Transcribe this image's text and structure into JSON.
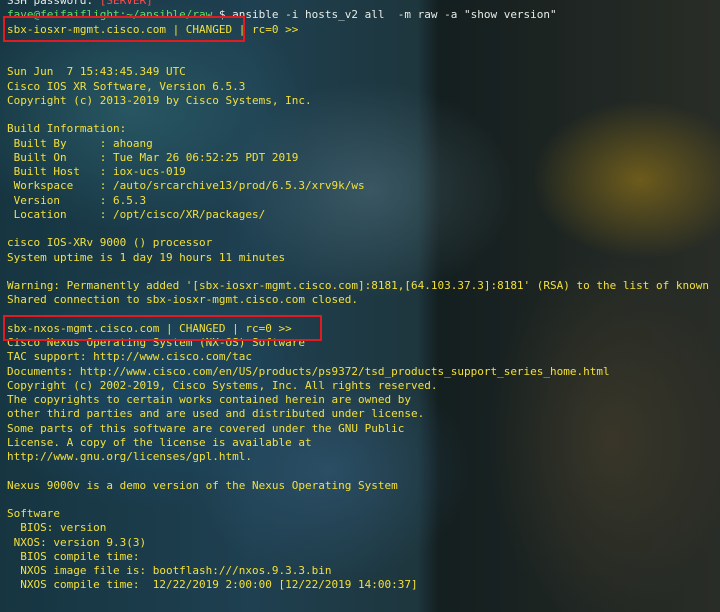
{
  "colors": {
    "prompt_text": "#e8ede8",
    "output_text": "#f2e03c",
    "password_text": "#ff4b4b",
    "prompt_user": "#5fe06b",
    "highlight_box": "#e11b22"
  },
  "terminal": {
    "lines": [
      {
        "parts": [
          {
            "text": "SSH password: ",
            "c": "w"
          },
          {
            "text": "[SERVER] ",
            "c": "r"
          }
        ]
      },
      {
        "parts": [
          {
            "text": "fave@feifaiflight:~/ansible/raw ",
            "c": "g"
          },
          {
            "text": "$ ansible -i hosts_v2 all  -m raw -a \"show version\"",
            "c": "w"
          }
        ]
      },
      {
        "text": "sbx-iosxr-mgmt.cisco.com | CHANGED | rc=0 >>",
        "c": "y"
      },
      {
        "text": "",
        "c": "y"
      },
      {
        "text": "",
        "c": "y"
      },
      {
        "text": "Sun Jun  7 15:43:45.349 UTC",
        "c": "y"
      },
      {
        "text": "Cisco IOS XR Software, Version 6.5.3",
        "c": "y"
      },
      {
        "text": "Copyright (c) 2013-2019 by Cisco Systems, Inc.",
        "c": "y"
      },
      {
        "text": "",
        "c": "y"
      },
      {
        "text": "Build Information:",
        "c": "y"
      },
      {
        "text": " Built By     : ahoang",
        "c": "y"
      },
      {
        "text": " Built On     : Tue Mar 26 06:52:25 PDT 2019",
        "c": "y"
      },
      {
        "text": " Built Host   : iox-ucs-019",
        "c": "y"
      },
      {
        "text": " Workspace    : /auto/srcarchive13/prod/6.5.3/xrv9k/ws",
        "c": "y"
      },
      {
        "text": " Version      : 6.5.3",
        "c": "y"
      },
      {
        "text": " Location     : /opt/cisco/XR/packages/",
        "c": "y"
      },
      {
        "text": "",
        "c": "y"
      },
      {
        "text": "cisco IOS-XRv 9000 () processor",
        "c": "y"
      },
      {
        "text": "System uptime is 1 day 19 hours 11 minutes",
        "c": "y"
      },
      {
        "text": "",
        "c": "y"
      },
      {
        "text": "Warning: Permanently added '[sbx-iosxr-mgmt.cisco.com]:8181,[64.103.37.3]:8181' (RSA) to the list of known",
        "c": "y"
      },
      {
        "text": "Shared connection to sbx-iosxr-mgmt.cisco.com closed.",
        "c": "y"
      },
      {
        "text": "",
        "c": "y"
      },
      {
        "text": "sbx-nxos-mgmt.cisco.com | CHANGED | rc=0 >>",
        "c": "y"
      },
      {
        "text": "Cisco Nexus Operating System (NX-OS) Software",
        "c": "y"
      },
      {
        "text": "TAC support: http://www.cisco.com/tac",
        "c": "y"
      },
      {
        "text": "Documents: http://www.cisco.com/en/US/products/ps9372/tsd_products_support_series_home.html",
        "c": "y"
      },
      {
        "text": "Copyright (c) 2002-2019, Cisco Systems, Inc. All rights reserved.",
        "c": "y"
      },
      {
        "text": "The copyrights to certain works contained herein are owned by",
        "c": "y"
      },
      {
        "text": "other third parties and are used and distributed under license.",
        "c": "y"
      },
      {
        "text": "Some parts of this software are covered under the GNU Public",
        "c": "y"
      },
      {
        "text": "License. A copy of the license is available at",
        "c": "y"
      },
      {
        "text": "http://www.gnu.org/licenses/gpl.html.",
        "c": "y"
      },
      {
        "text": "",
        "c": "y"
      },
      {
        "text": "Nexus 9000v is a demo version of the Nexus Operating System",
        "c": "y"
      },
      {
        "text": "",
        "c": "y"
      },
      {
        "text": "Software",
        "c": "y"
      },
      {
        "text": "  BIOS: version",
        "c": "y"
      },
      {
        "text": " NXOS: version 9.3(3)",
        "c": "y"
      },
      {
        "text": "  BIOS compile time:",
        "c": "y"
      },
      {
        "text": "  NXOS image file is: bootflash:///nxos.9.3.3.bin",
        "c": "y"
      },
      {
        "text": "  NXOS compile time:  12/22/2019 2:00:00 [12/22/2019 14:00:37]",
        "c": "y"
      }
    ]
  }
}
